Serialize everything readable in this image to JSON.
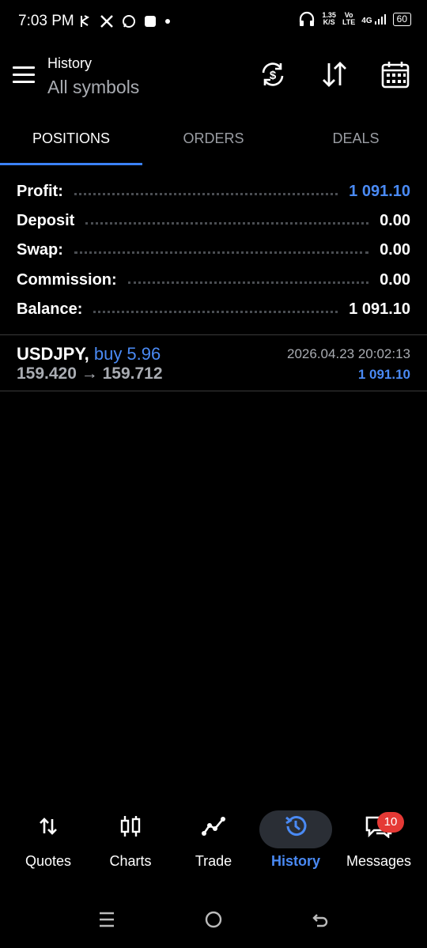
{
  "status_bar": {
    "time": "7:03 PM",
    "net_speed_value": "1.35",
    "net_speed_unit": "K/S",
    "volte_top": "Vo",
    "volte_bottom": "LTE",
    "network": "4G",
    "battery": "60"
  },
  "header": {
    "title": "History",
    "subtitle": "All symbols",
    "icons": [
      "sync-currency-icon",
      "sort-icon",
      "calendar-icon"
    ]
  },
  "tabs": [
    {
      "label": "POSITIONS",
      "active": true
    },
    {
      "label": "ORDERS",
      "active": false
    },
    {
      "label": "DEALS",
      "active": false
    }
  ],
  "summary": [
    {
      "label": "Profit:",
      "value": "1 091.10",
      "highlight": true
    },
    {
      "label": "Deposit",
      "value": "0.00",
      "highlight": false
    },
    {
      "label": "Swap:",
      "value": "0.00",
      "highlight": false
    },
    {
      "label": "Commission:",
      "value": "0.00",
      "highlight": false
    },
    {
      "label": "Balance:",
      "value": "1 091.10",
      "highlight": false
    }
  ],
  "position": {
    "symbol": "USDJPY,",
    "side": "buy 5.96",
    "open_price": "159.420",
    "arrow": "→",
    "close_price": "159.712",
    "time": "2026.04.23 20:02:13",
    "profit": "1 091.10"
  },
  "bottom_nav": [
    {
      "label": "Quotes",
      "icon": "quotes-icon",
      "active": false
    },
    {
      "label": "Charts",
      "icon": "candles-icon",
      "active": false
    },
    {
      "label": "Trade",
      "icon": "trade-icon",
      "active": false
    },
    {
      "label": "History",
      "icon": "history-icon",
      "active": true
    },
    {
      "label": "Messages",
      "icon": "messages-icon",
      "active": false,
      "badge": "10"
    }
  ],
  "colors": {
    "background": "#000000",
    "accent": "#4a8af4",
    "muted": "#a9acb2",
    "badge": "#e53935"
  }
}
